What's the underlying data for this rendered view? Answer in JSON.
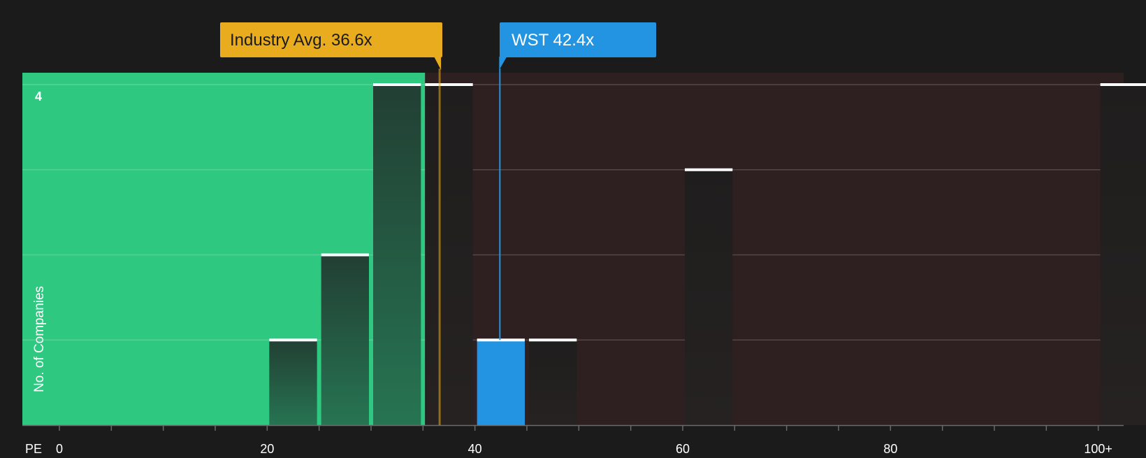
{
  "chart_data": {
    "type": "bar",
    "x_axis_label": "PE",
    "y_axis_label": "No. of Companies",
    "x_ticks": [
      "0",
      "20",
      "40",
      "60",
      "80",
      "100+"
    ],
    "x_tick_values": [
      0,
      20,
      40,
      60,
      80,
      100
    ],
    "y_tick_labels": [
      "4"
    ],
    "ylim": [
      0,
      4
    ],
    "xlim": [
      0,
      105
    ],
    "bin_width": 5,
    "bars": [
      {
        "x_start": 20,
        "x_end": 25,
        "value": 1
      },
      {
        "x_start": 25,
        "x_end": 30,
        "value": 2
      },
      {
        "x_start": 30,
        "x_end": 35,
        "value": 4
      },
      {
        "x_start": 35,
        "x_end": 40,
        "value": 4
      },
      {
        "x_start": 40,
        "x_end": 45,
        "value": 1,
        "highlight": true
      },
      {
        "x_start": 45,
        "x_end": 50,
        "value": 1
      },
      {
        "x_start": 60,
        "x_end": 65,
        "value": 3
      },
      {
        "x_start": 100,
        "x_end": 105,
        "value": 4
      }
    ],
    "green_zone_end": 35,
    "industry_avg": {
      "label": "Industry Avg. 36.6x",
      "value": 36.6
    },
    "company": {
      "label": "WST 42.4x",
      "value": 42.4
    },
    "grid": true
  },
  "colors": {
    "background": "#1b1b1b",
    "green_zone": "#2ec880",
    "red_zone": "#2e1f20",
    "bar_in_green": "#24483a",
    "bar_in_red": "#211f1f",
    "bar_cap": "#ffffff",
    "highlight_bar": "#2394e1",
    "industry_marker": "#e8ac1e",
    "company_marker": "#2394e1",
    "grid_line": "#5a5a5a",
    "axis_text": "#ffffff"
  }
}
